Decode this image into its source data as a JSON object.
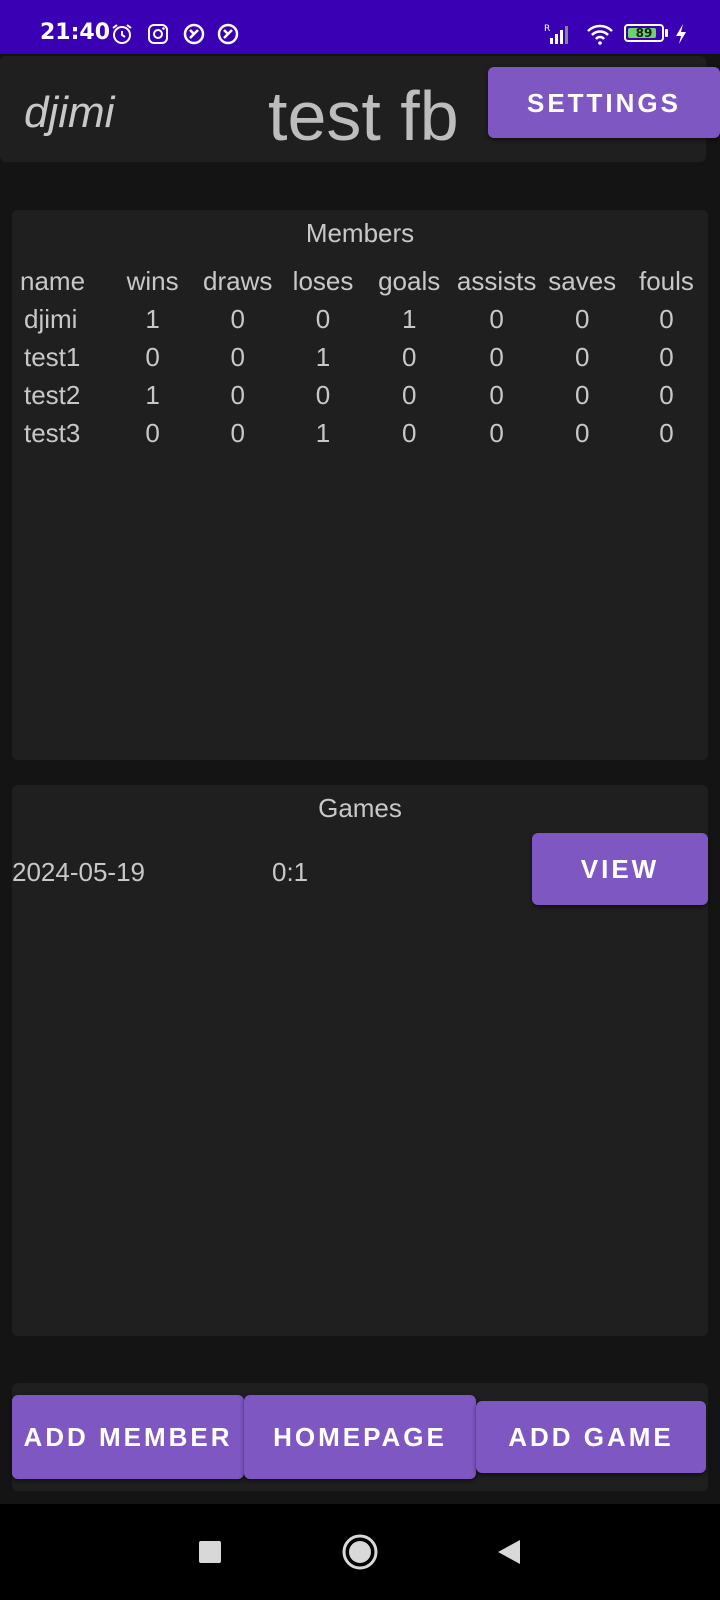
{
  "status_bar": {
    "time": "21:40",
    "battery": "89",
    "battery_level": 0.89,
    "signal_label": "R",
    "icons": [
      "alarm-icon",
      "instagram-icon",
      "notification-icon",
      "notification-icon",
      "signal-icon",
      "wifi-icon",
      "battery-icon",
      "charging-icon"
    ]
  },
  "header": {
    "user": "djimi",
    "group_title": "test fb",
    "settings_label": "SETTINGS"
  },
  "members": {
    "title": "Members",
    "columns": [
      "name",
      "wins",
      "draws",
      "loses",
      "goals",
      "assists",
      "saves",
      "fouls"
    ],
    "rows": [
      [
        "djimi",
        "1",
        "0",
        "0",
        "1",
        "0",
        "0",
        "0"
      ],
      [
        "test1",
        "0",
        "0",
        "1",
        "0",
        "0",
        "0",
        "0"
      ],
      [
        "test2",
        "1",
        "0",
        "0",
        "0",
        "0",
        "0",
        "0"
      ],
      [
        "test3",
        "0",
        "0",
        "1",
        "0",
        "0",
        "0",
        "0"
      ]
    ]
  },
  "games": {
    "title": "Games",
    "items": [
      {
        "date": "2024-05-19",
        "score": "0:1",
        "view_label": "VIEW"
      }
    ]
  },
  "actions": {
    "add_member_label": "ADD MEMBER",
    "homepage_label": "HOMEPAGE",
    "add_game_label": "ADD GAME"
  },
  "colors": {
    "status_bar": "#3a00b3",
    "accent": "#7e57c2",
    "background": "#141414",
    "surface": "#1f1f1f"
  },
  "nav": {
    "icons": [
      "recents-square-icon",
      "home-circle-icon",
      "back-triangle-icon"
    ]
  }
}
